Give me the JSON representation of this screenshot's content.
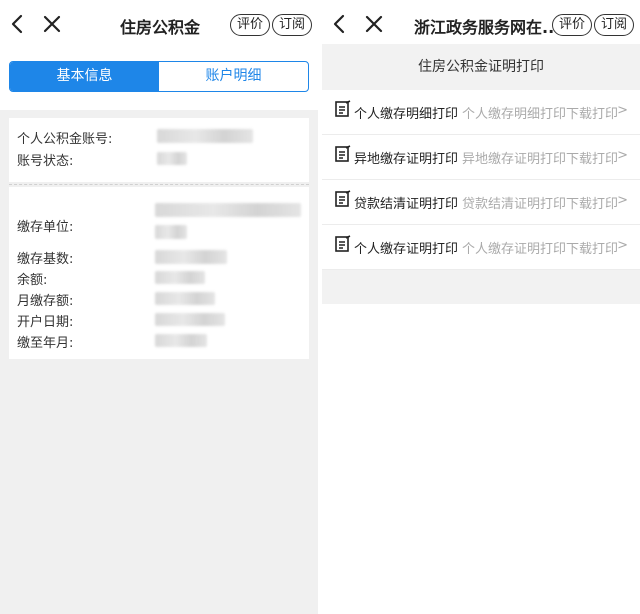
{
  "left": {
    "title": "住房公积金",
    "rate_label": "评价",
    "subscribe_label": "订阅",
    "tabs": [
      {
        "label": "基本信息",
        "active": true
      },
      {
        "label": "账户明细",
        "active": false
      }
    ],
    "account_card": [
      {
        "label": "个人公积金账号:"
      },
      {
        "label": "账号状态:"
      }
    ],
    "detail_card": [
      {
        "label": "缴存单位:"
      },
      {
        "label": "缴存基数:"
      },
      {
        "label": "余额:"
      },
      {
        "label": "月缴存额:"
      },
      {
        "label": "开户日期:"
      },
      {
        "label": "缴至年月:"
      }
    ]
  },
  "right": {
    "title": "浙江政务服务网在...",
    "rate_label": "评价",
    "subscribe_label": "订阅",
    "section_header": "住房公积金证明打印",
    "items": [
      {
        "label": "个人缴存明细打印",
        "subtitle": "个人缴存明细打印下载打印",
        "chevron": ">"
      },
      {
        "label": "异地缴存证明打印",
        "subtitle": "异地缴存证明打印下载打印",
        "chevron": ">"
      },
      {
        "label": "贷款结清证明打印",
        "subtitle": "贷款结清证明打印下载打印",
        "chevron": ">"
      },
      {
        "label": "个人缴存证明打印",
        "subtitle": "个人缴存证明打印下载打印",
        "chevron": ">"
      }
    ]
  },
  "colors": {
    "accent": "#1e86e8",
    "page_bg": "#f0f0f0",
    "muted_text": "#aaaaaa"
  },
  "icons": {
    "back": "chevron-left-icon",
    "close": "close-icon",
    "item": "document-edit-icon"
  }
}
